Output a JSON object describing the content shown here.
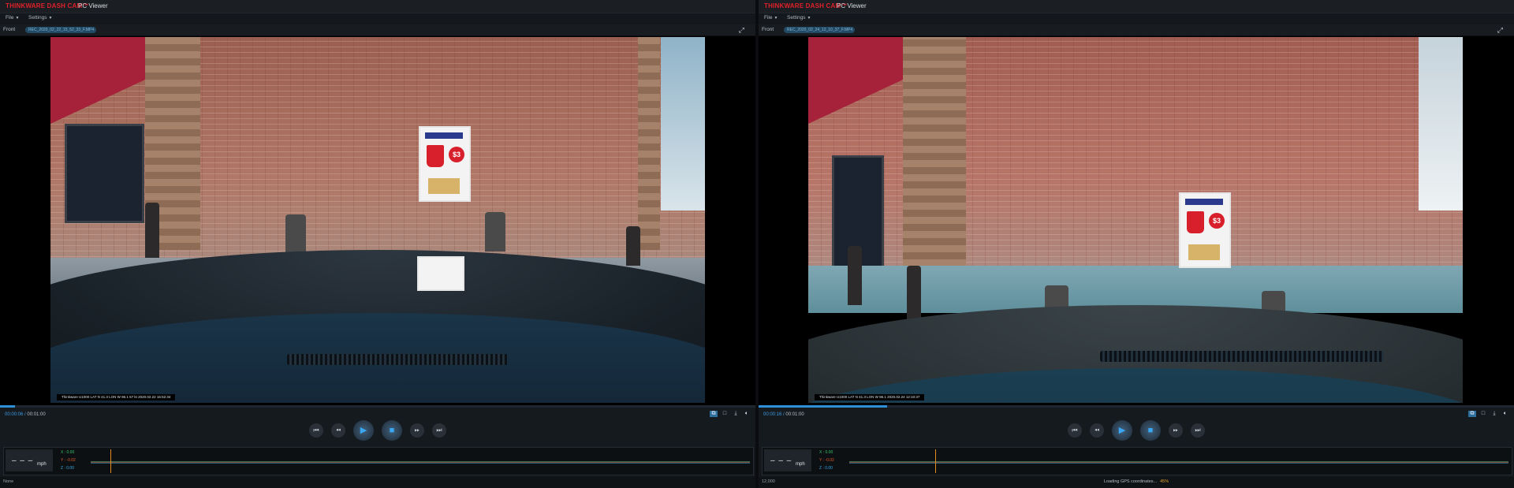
{
  "panes": [
    {
      "brand": "THINKWARE DASH CAM™",
      "app_title": "PC Viewer",
      "menu": {
        "file": "File",
        "settings": "Settings"
      },
      "camera_label": "Front",
      "file_name": "REC_2020_02_22_15_52_33_F.MP4",
      "osd_text": "Thinkware U1000  LAT  N 41.3  LON  W 96.1   57 kt    2020.02.22 15:52:34",
      "time": {
        "current": "00:00:06",
        "total": "00:01:00"
      },
      "progress": 0.02,
      "controls": [
        "prev",
        "rewind",
        "play",
        "stop",
        "fast-forward",
        "next"
      ],
      "speed": {
        "value": "– – –",
        "unit": "mph"
      },
      "gsensor": {
        "x": "X : 0.00",
        "y": "Y : -0.02",
        "z": "Z : 0.00"
      },
      "cursor": 0.03,
      "status_left": "None",
      "status_center": "",
      "status_pct": ""
    },
    {
      "brand": "THINKWARE DASH CAM™",
      "app_title": "PC Viewer",
      "menu": {
        "file": "File",
        "settings": "Settings"
      },
      "camera_label": "Front",
      "file_name": "REC_2020_02_24_12_10_37_F.MP4",
      "osd_text": "Thinkware U1000  LAT  N 41.3  LON  W 96.1      2020.02.24 12:10:37",
      "time": {
        "current": "00:00:16",
        "total": "00:01:00"
      },
      "progress": 0.17,
      "controls": [
        "prev",
        "rewind",
        "play",
        "stop",
        "fast-forward",
        "next"
      ],
      "speed": {
        "value": "– – –",
        "unit": "mph"
      },
      "gsensor": {
        "x": "X : 0.00",
        "y": "Y : -0.02",
        "z": "Z : 0.00"
      },
      "cursor": 0.13,
      "status_left": "12,000",
      "status_center": "Loading GPS coordinates...",
      "status_pct": "45%"
    }
  ],
  "colors": {
    "brand_red": "#e0202a",
    "accent_blue": "#2f8fd8",
    "gsensor_x": "#37c26b",
    "gsensor_y": "#e05a2b",
    "gsensor_z": "#3aa7e6",
    "cursor": "#e88b1e"
  },
  "icons": {
    "prev": "prev-track-icon",
    "rewind": "rewind-icon",
    "play": "play-icon",
    "stop": "stop-icon",
    "fast-forward": "fast-forward-icon",
    "next": "next-track-icon"
  }
}
